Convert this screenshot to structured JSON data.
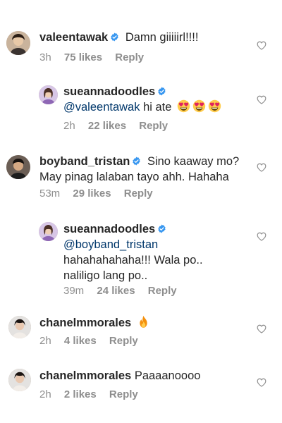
{
  "comments": [
    {
      "username": "valeentawak",
      "verified": true,
      "text": "Damn giiiiirl!!!!",
      "time": "3h",
      "likes": "75 likes",
      "reply": "Reply",
      "avatar": "avatar-photo"
    },
    {
      "username": "sueannadoodles",
      "verified": true,
      "mention": "@valeentawak",
      "text": "hi ate",
      "emojis": [
        "heart-eyes-emoji",
        "heart-eyes-emoji",
        "heart-eyes-emoji"
      ],
      "time": "2h",
      "likes": "22 likes",
      "reply": "Reply",
      "avatar": "avatar-photo"
    },
    {
      "username": "boyband_tristan",
      "verified": true,
      "text_line1": "Sino kaaway mo?",
      "text_line2": "May pinag lalaban tayo ahh. Hahaha",
      "time": "53m",
      "likes": "29 likes",
      "reply": "Reply",
      "avatar": "avatar-photo"
    },
    {
      "username": "sueannadoodles",
      "verified": true,
      "mention": "@boyband_tristan",
      "text_line1": "hahahahahaha!!! Wala po..",
      "text_line2": "naliligo lang po..",
      "time": "39m",
      "likes": "24 likes",
      "reply": "Reply",
      "avatar": "avatar-photo"
    },
    {
      "username": "chanelmmorales",
      "verified": false,
      "emojis": [
        "fire-emoji"
      ],
      "time": "2h",
      "likes": "4 likes",
      "reply": "Reply",
      "avatar": "avatar-photo"
    },
    {
      "username": "chanelmmorales",
      "verified": false,
      "text": "Paaaanoooo",
      "time": "2h",
      "likes": "2 likes",
      "reply": "Reply",
      "avatar": "avatar-photo"
    }
  ],
  "colors": {
    "verified": "#3897f0",
    "mention": "#00376b",
    "meta": "#8e8e8e",
    "text": "#262626"
  },
  "icons": {
    "like": "heart-outline-icon",
    "verified": "verified-badge-icon"
  }
}
